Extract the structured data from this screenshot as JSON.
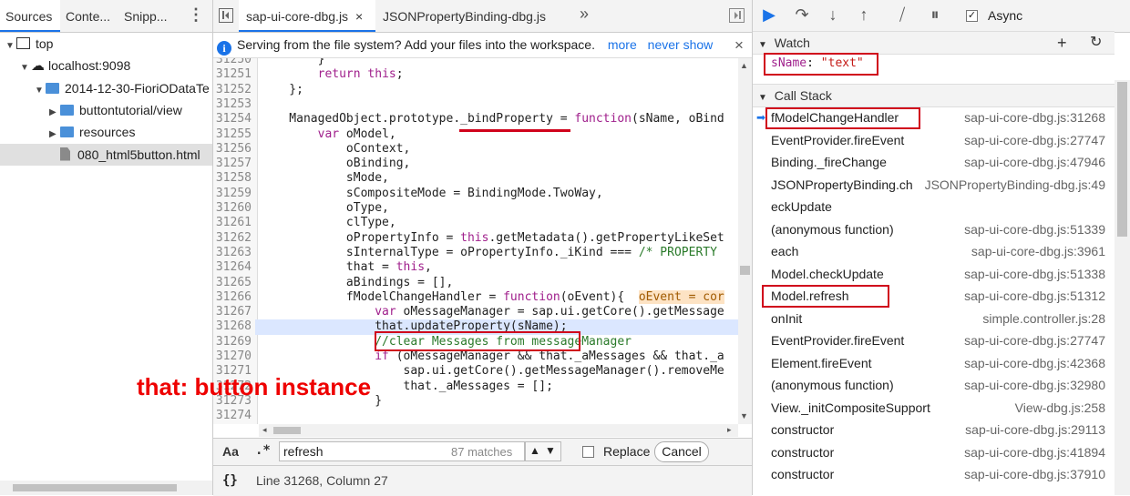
{
  "navigator": {
    "tabs": [
      "Sources",
      "Conte...",
      "Snipp..."
    ],
    "tree": [
      {
        "label": "top",
        "indent": 0,
        "type": "frame",
        "expanded": true
      },
      {
        "label": "localhost:9098",
        "indent": 1,
        "type": "cloud",
        "expanded": true
      },
      {
        "label": "2014-12-30-FioriODataTe",
        "indent": 2,
        "type": "folder",
        "expanded": true
      },
      {
        "label": "buttontutorial/view",
        "indent": 3,
        "type": "folder",
        "expanded": false
      },
      {
        "label": "resources",
        "indent": 3,
        "type": "folder",
        "expanded": false
      },
      {
        "label": "080_html5button.html",
        "indent": 3,
        "type": "file",
        "selected": true
      }
    ]
  },
  "editor": {
    "tabs": [
      {
        "label": "sap-ui-core-dbg.js",
        "active": true,
        "closable": true
      },
      {
        "label": "JSONPropertyBinding-dbg.js",
        "active": false
      }
    ],
    "overflow": "»",
    "infobar": {
      "message": "Serving from the file system? Add your files into the workspace.",
      "more": "more",
      "never_show": "never show"
    },
    "lines": [
      {
        "n": "31250",
        "t": "        }"
      },
      {
        "n": "31251",
        "t": "        return this;"
      },
      {
        "n": "31252",
        "t": "    };"
      },
      {
        "n": "31253",
        "t": ""
      },
      {
        "n": "31254",
        "t": "    ManagedObject.prototype._bindProperty = function(sName, oBind"
      },
      {
        "n": "31255",
        "t": "        var oModel,"
      },
      {
        "n": "31256",
        "t": "            oContext,"
      },
      {
        "n": "31257",
        "t": "            oBinding,"
      },
      {
        "n": "31258",
        "t": "            sMode,"
      },
      {
        "n": "31259",
        "t": "            sCompositeMode = BindingMode.TwoWay,"
      },
      {
        "n": "31260",
        "t": "            oType,"
      },
      {
        "n": "31261",
        "t": "            clType,"
      },
      {
        "n": "31262",
        "t": "            oPropertyInfo = this.getMetadata().getPropertyLikeSet"
      },
      {
        "n": "31263",
        "t": "            sInternalType = oPropertyInfo._iKind === /* PROPERTY"
      },
      {
        "n": "31264",
        "t": "            that = this,"
      },
      {
        "n": "31265",
        "t": "            aBindings = [],"
      },
      {
        "n": "31266",
        "t": "            fModelChangeHandler = function(oEvent){  "
      },
      {
        "n": "31267",
        "t": "                var oMessageManager = sap.ui.getCore().getMessage"
      },
      {
        "n": "31268",
        "t": "                that.updateProperty(sName);"
      },
      {
        "n": "31269",
        "t": "                //clear Messages from messageManager"
      },
      {
        "n": "31270",
        "t": "                if (oMessageManager && that._aMessages && that._a"
      },
      {
        "n": "31271",
        "t": "                    sap.ui.getCore().getMessageManager().removeMe"
      },
      {
        "n": "31272",
        "t": "                    that._aMessages = [];"
      },
      {
        "n": "31273",
        "t": "                }"
      },
      {
        "n": "31274",
        "t": ""
      }
    ],
    "eval_hint": "oEvent = cor",
    "search": {
      "case_label": "Aa",
      "regex_label": ".*",
      "value": "refresh",
      "matches": "87 matches",
      "replace_label": "Replace",
      "cancel_label": "Cancel"
    },
    "status": {
      "braces": "{}",
      "position": "Line 31268, Column 27"
    }
  },
  "annotation": "that: button instance",
  "debugger": {
    "async_label": "Async",
    "watch": {
      "title": "Watch",
      "expr_name": "sName",
      "expr_value": "\"text\""
    },
    "callstack": {
      "title": "Call Stack",
      "frames": [
        {
          "fn": "fModelChangeHandler",
          "loc": "sap-ui-core-dbg.js:31268",
          "current": true
        },
        {
          "fn": "EventProvider.fireEvent",
          "loc": "sap-ui-core-dbg.js:27747"
        },
        {
          "fn": "Binding._fireChange",
          "loc": "sap-ui-core-dbg.js:47946"
        },
        {
          "fn": "JSONPropertyBinding.ch",
          "loc": "JSONPropertyBinding-dbg.js:49"
        },
        {
          "fn": "eckUpdate",
          "loc": ""
        },
        {
          "fn": "(anonymous function)",
          "loc": "sap-ui-core-dbg.js:51339"
        },
        {
          "fn": "each",
          "loc": "sap-ui-core-dbg.js:3961"
        },
        {
          "fn": "Model.checkUpdate",
          "loc": "sap-ui-core-dbg.js:51338"
        },
        {
          "fn": "Model.refresh",
          "loc": "sap-ui-core-dbg.js:51312"
        },
        {
          "fn": "onInit",
          "loc": "simple.controller.js:28"
        },
        {
          "fn": "EventProvider.fireEvent",
          "loc": "sap-ui-core-dbg.js:27747"
        },
        {
          "fn": "Element.fireEvent",
          "loc": "sap-ui-core-dbg.js:42368"
        },
        {
          "fn": "(anonymous function)",
          "loc": "sap-ui-core-dbg.js:32980"
        },
        {
          "fn": "View._initCompositeSupport",
          "loc": "View-dbg.js:258"
        },
        {
          "fn": "constructor",
          "loc": "sap-ui-core-dbg.js:29113"
        },
        {
          "fn": "constructor",
          "loc": "sap-ui-core-dbg.js:41894"
        },
        {
          "fn": "constructor",
          "loc": "sap-ui-core-dbg.js:37910"
        }
      ]
    }
  }
}
